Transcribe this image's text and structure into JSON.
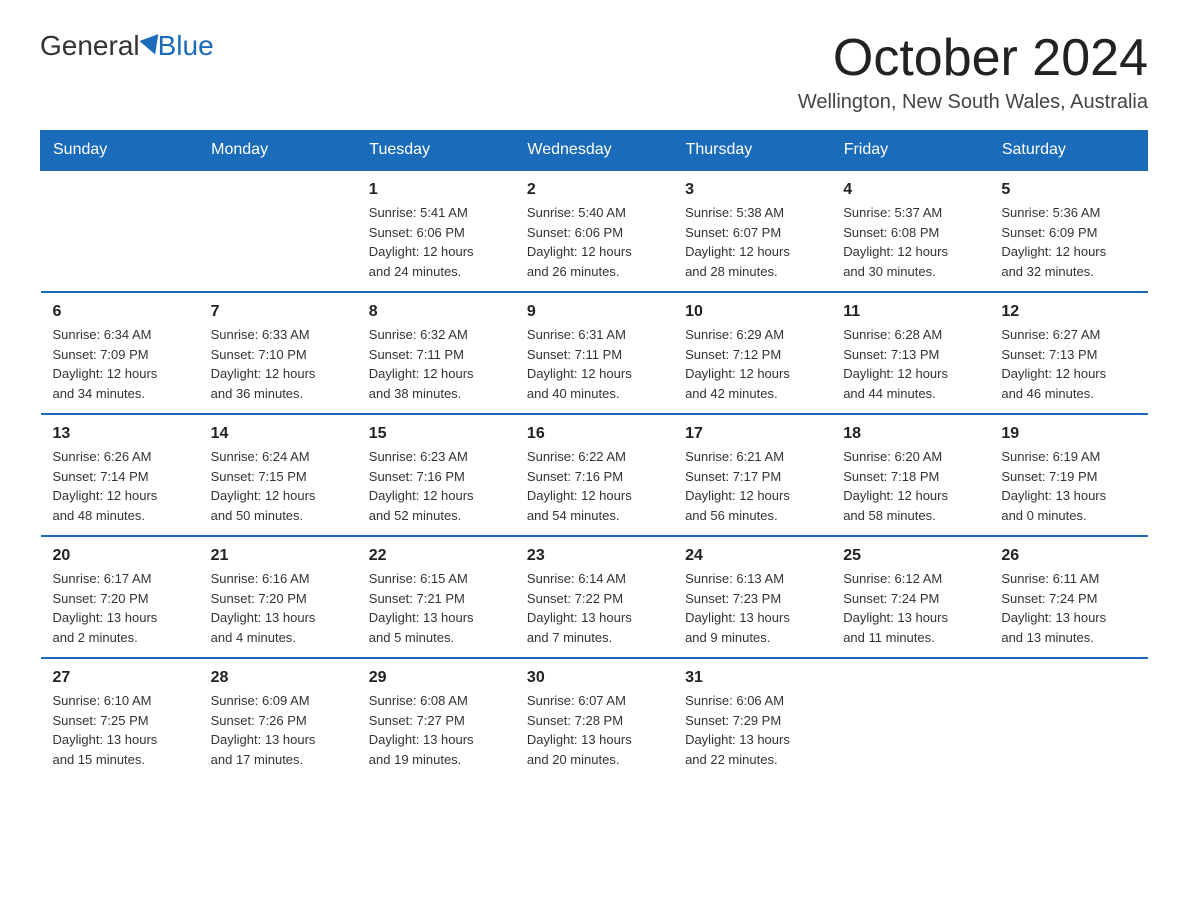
{
  "header": {
    "logo_general": "General",
    "logo_blue": "Blue",
    "title": "October 2024",
    "subtitle": "Wellington, New South Wales, Australia"
  },
  "days_of_week": [
    "Sunday",
    "Monday",
    "Tuesday",
    "Wednesday",
    "Thursday",
    "Friday",
    "Saturday"
  ],
  "weeks": [
    [
      {
        "day": "",
        "info": ""
      },
      {
        "day": "",
        "info": ""
      },
      {
        "day": "1",
        "info": "Sunrise: 5:41 AM\nSunset: 6:06 PM\nDaylight: 12 hours\nand 24 minutes."
      },
      {
        "day": "2",
        "info": "Sunrise: 5:40 AM\nSunset: 6:06 PM\nDaylight: 12 hours\nand 26 minutes."
      },
      {
        "day": "3",
        "info": "Sunrise: 5:38 AM\nSunset: 6:07 PM\nDaylight: 12 hours\nand 28 minutes."
      },
      {
        "day": "4",
        "info": "Sunrise: 5:37 AM\nSunset: 6:08 PM\nDaylight: 12 hours\nand 30 minutes."
      },
      {
        "day": "5",
        "info": "Sunrise: 5:36 AM\nSunset: 6:09 PM\nDaylight: 12 hours\nand 32 minutes."
      }
    ],
    [
      {
        "day": "6",
        "info": "Sunrise: 6:34 AM\nSunset: 7:09 PM\nDaylight: 12 hours\nand 34 minutes."
      },
      {
        "day": "7",
        "info": "Sunrise: 6:33 AM\nSunset: 7:10 PM\nDaylight: 12 hours\nand 36 minutes."
      },
      {
        "day": "8",
        "info": "Sunrise: 6:32 AM\nSunset: 7:11 PM\nDaylight: 12 hours\nand 38 minutes."
      },
      {
        "day": "9",
        "info": "Sunrise: 6:31 AM\nSunset: 7:11 PM\nDaylight: 12 hours\nand 40 minutes."
      },
      {
        "day": "10",
        "info": "Sunrise: 6:29 AM\nSunset: 7:12 PM\nDaylight: 12 hours\nand 42 minutes."
      },
      {
        "day": "11",
        "info": "Sunrise: 6:28 AM\nSunset: 7:13 PM\nDaylight: 12 hours\nand 44 minutes."
      },
      {
        "day": "12",
        "info": "Sunrise: 6:27 AM\nSunset: 7:13 PM\nDaylight: 12 hours\nand 46 minutes."
      }
    ],
    [
      {
        "day": "13",
        "info": "Sunrise: 6:26 AM\nSunset: 7:14 PM\nDaylight: 12 hours\nand 48 minutes."
      },
      {
        "day": "14",
        "info": "Sunrise: 6:24 AM\nSunset: 7:15 PM\nDaylight: 12 hours\nand 50 minutes."
      },
      {
        "day": "15",
        "info": "Sunrise: 6:23 AM\nSunset: 7:16 PM\nDaylight: 12 hours\nand 52 minutes."
      },
      {
        "day": "16",
        "info": "Sunrise: 6:22 AM\nSunset: 7:16 PM\nDaylight: 12 hours\nand 54 minutes."
      },
      {
        "day": "17",
        "info": "Sunrise: 6:21 AM\nSunset: 7:17 PM\nDaylight: 12 hours\nand 56 minutes."
      },
      {
        "day": "18",
        "info": "Sunrise: 6:20 AM\nSunset: 7:18 PM\nDaylight: 12 hours\nand 58 minutes."
      },
      {
        "day": "19",
        "info": "Sunrise: 6:19 AM\nSunset: 7:19 PM\nDaylight: 13 hours\nand 0 minutes."
      }
    ],
    [
      {
        "day": "20",
        "info": "Sunrise: 6:17 AM\nSunset: 7:20 PM\nDaylight: 13 hours\nand 2 minutes."
      },
      {
        "day": "21",
        "info": "Sunrise: 6:16 AM\nSunset: 7:20 PM\nDaylight: 13 hours\nand 4 minutes."
      },
      {
        "day": "22",
        "info": "Sunrise: 6:15 AM\nSunset: 7:21 PM\nDaylight: 13 hours\nand 5 minutes."
      },
      {
        "day": "23",
        "info": "Sunrise: 6:14 AM\nSunset: 7:22 PM\nDaylight: 13 hours\nand 7 minutes."
      },
      {
        "day": "24",
        "info": "Sunrise: 6:13 AM\nSunset: 7:23 PM\nDaylight: 13 hours\nand 9 minutes."
      },
      {
        "day": "25",
        "info": "Sunrise: 6:12 AM\nSunset: 7:24 PM\nDaylight: 13 hours\nand 11 minutes."
      },
      {
        "day": "26",
        "info": "Sunrise: 6:11 AM\nSunset: 7:24 PM\nDaylight: 13 hours\nand 13 minutes."
      }
    ],
    [
      {
        "day": "27",
        "info": "Sunrise: 6:10 AM\nSunset: 7:25 PM\nDaylight: 13 hours\nand 15 minutes."
      },
      {
        "day": "28",
        "info": "Sunrise: 6:09 AM\nSunset: 7:26 PM\nDaylight: 13 hours\nand 17 minutes."
      },
      {
        "day": "29",
        "info": "Sunrise: 6:08 AM\nSunset: 7:27 PM\nDaylight: 13 hours\nand 19 minutes."
      },
      {
        "day": "30",
        "info": "Sunrise: 6:07 AM\nSunset: 7:28 PM\nDaylight: 13 hours\nand 20 minutes."
      },
      {
        "day": "31",
        "info": "Sunrise: 6:06 AM\nSunset: 7:29 PM\nDaylight: 13 hours\nand 22 minutes."
      },
      {
        "day": "",
        "info": ""
      },
      {
        "day": "",
        "info": ""
      }
    ]
  ]
}
